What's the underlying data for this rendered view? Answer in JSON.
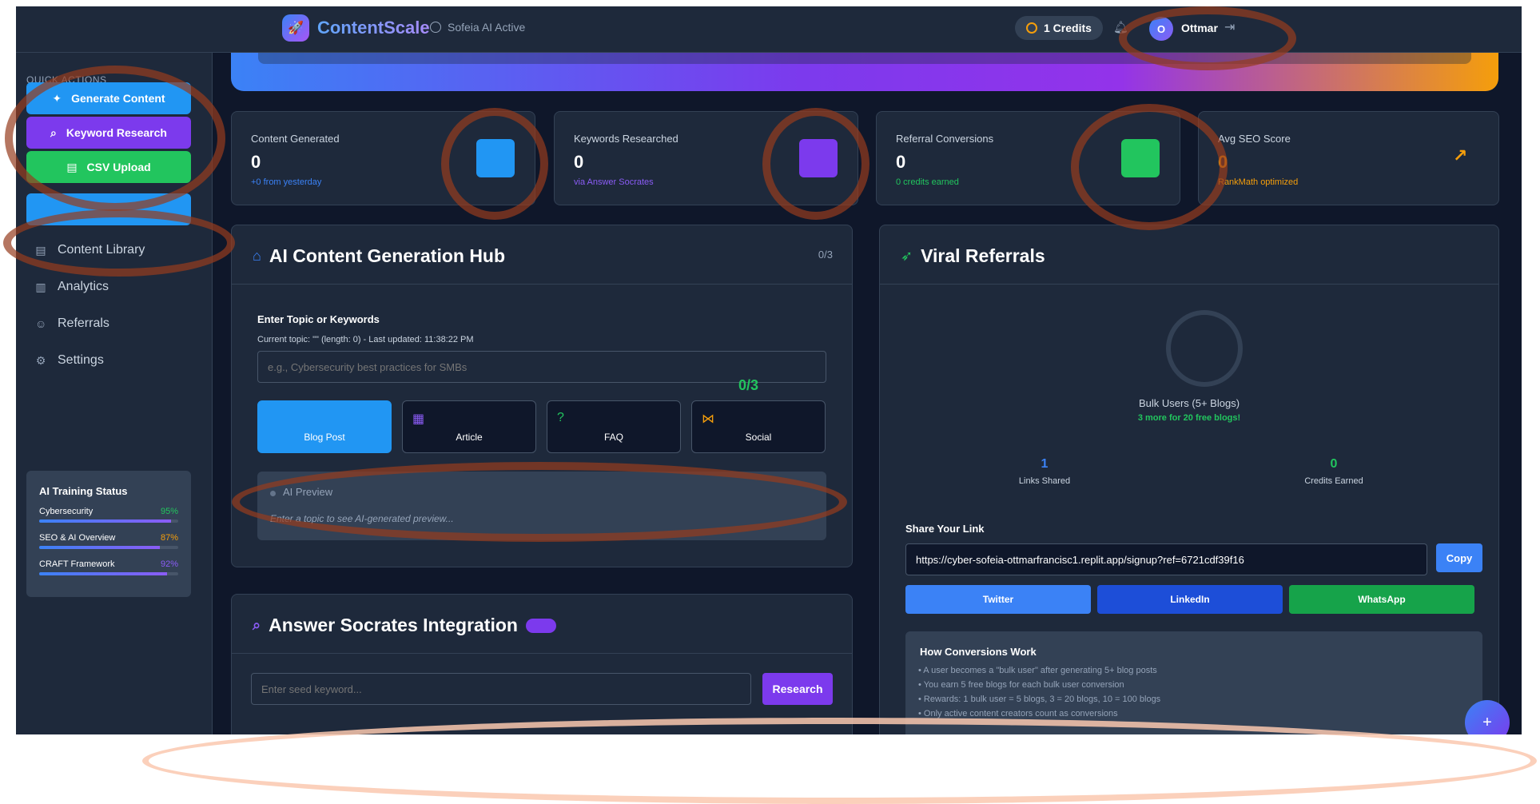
{
  "topbar": {
    "brand": "ContentScale",
    "ai_status": "Sofeia AI Active",
    "credits": "1 Credits",
    "avatar_initial": "O",
    "username": "Ottmar"
  },
  "sidebar": {
    "quick_actions_title": "QUICK ACTIONS",
    "quick_actions": [
      {
        "label": "Generate Content",
        "color": "#2196f3"
      },
      {
        "label": "Keyword Research",
        "color": "#7c3aed"
      },
      {
        "label": "CSV Upload",
        "color": "#22c55e"
      },
      {
        "label": "",
        "color": "#2196f3"
      }
    ],
    "nav": [
      {
        "label": "Content Library",
        "icon": "document-icon"
      },
      {
        "label": "Analytics",
        "icon": "bar-chart-icon"
      },
      {
        "label": "Referrals",
        "icon": "users-icon"
      },
      {
        "label": "Settings",
        "icon": "gear-icon"
      }
    ],
    "training": {
      "title": "AI Training Status",
      "items": [
        {
          "label": "Cybersecurity",
          "pct_text": "95%",
          "pct": 95,
          "color": "#22c55e"
        },
        {
          "label": "SEO & AI Overview",
          "pct_text": "87%",
          "pct": 87,
          "color": "#f59e0b"
        },
        {
          "label": "CRAFT Framework",
          "pct_text": "92%",
          "pct": 92,
          "color": "#8b5cf6"
        }
      ]
    }
  },
  "stats": [
    {
      "label": "Content Generated",
      "value": "0",
      "sub": "+0 from yesterday",
      "sub_color": "#3b82f6",
      "square_color": "#2196f3"
    },
    {
      "label": "Keywords Researched",
      "value": "0",
      "sub": "via Answer Socrates",
      "sub_color": "#8b5cf6",
      "square_color": "#7c3aed"
    },
    {
      "label": "Referral Conversions",
      "value": "0",
      "sub": "0 credits earned",
      "sub_color": "#22c55e",
      "square_color": "#22c55e"
    },
    {
      "label": "Avg SEO Score",
      "value": "0",
      "sub": "RankMath optimized",
      "sub_color": "#f59e0b",
      "icon": "trending-up-icon"
    }
  ],
  "hub": {
    "title": "AI Content Generation Hub",
    "counter": "0/3",
    "field_label": "Enter Topic or Keywords",
    "meta": "Current topic: \"\" (length: 0) - Last updated: 11:38:22 PM",
    "placeholder": "e.g., Cybersecurity best practices for SMBs",
    "floating_counter": "0/3",
    "types": [
      {
        "label": "Blog Post",
        "active": true
      },
      {
        "label": "Article",
        "icon": "newspaper-icon"
      },
      {
        "label": "FAQ",
        "icon": "question-circle-icon"
      },
      {
        "label": "Social",
        "icon": "share-icon"
      }
    ],
    "preview_title": "AI Preview",
    "preview_text": "Enter a topic to see AI-generated preview..."
  },
  "socrates": {
    "title": "Answer Socrates Integration",
    "placeholder": "Enter seed keyword...",
    "button": "Research"
  },
  "referrals": {
    "title": "Viral Referrals",
    "bulk_label": "Bulk Users (5+ Blogs)",
    "bulk_sub": "3 more for 20 free blogs!",
    "links_shared_value": "1",
    "links_shared_label": "Links Shared",
    "credits_earned_value": "0",
    "credits_earned_label": "Credits Earned",
    "share_label": "Share Your Link",
    "link": "https://cyber-sofeia-ottmarfrancisc1.replit.app/signup?ref=6721cdf39f16",
    "copy": "Copy",
    "social": [
      {
        "label": "Twitter",
        "color": "#3b82f6"
      },
      {
        "label": "LinkedIn",
        "color": "#1d4ed8"
      },
      {
        "label": "WhatsApp",
        "color": "#16a34a"
      }
    ],
    "how_title": "How Conversions Work",
    "how_items": [
      "• A user becomes a \"bulk user\" after generating 5+ blog posts",
      "• You earn 5 free blogs for each bulk user conversion",
      "• Rewards: 1 bulk user = 5 blogs, 3 = 20 blogs, 10 = 100 blogs",
      "• Only active content creators count as conversions"
    ]
  },
  "fab": "+"
}
